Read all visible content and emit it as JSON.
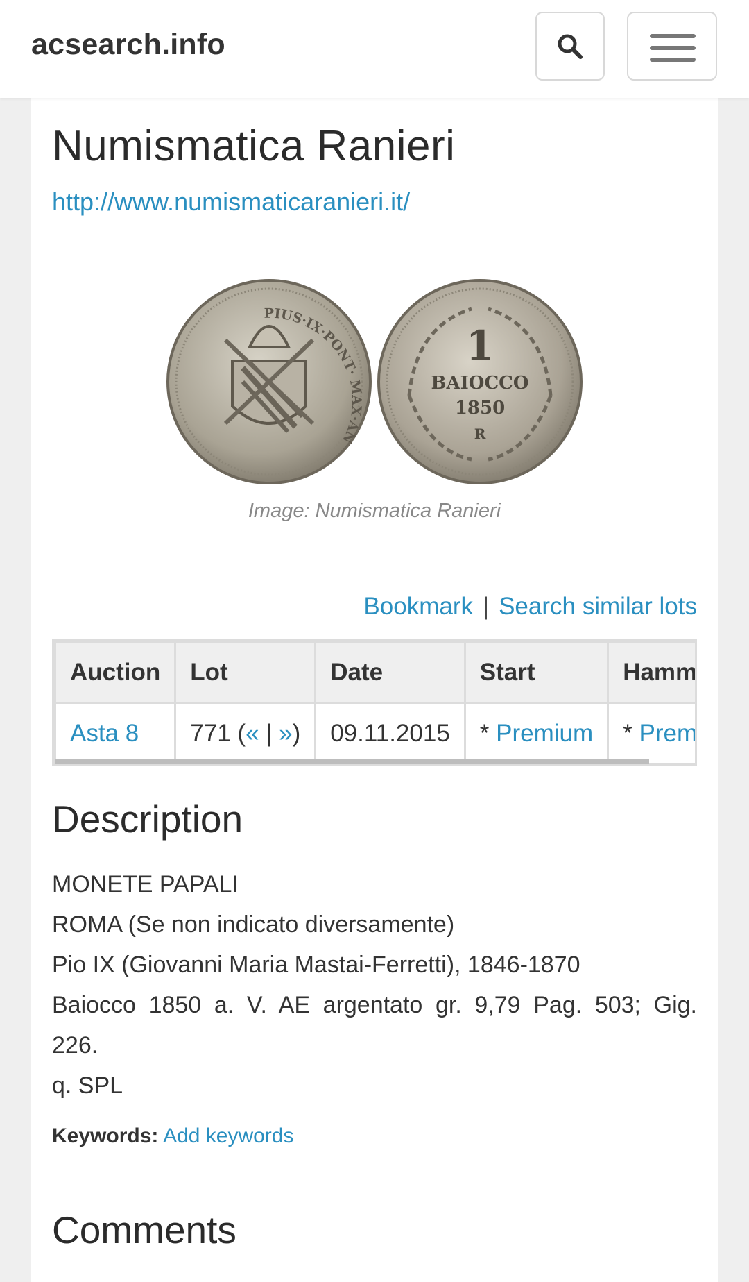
{
  "navbar": {
    "brand": "acsearch.info",
    "search_icon": "search-icon",
    "menu_icon": "hamburger-menu-icon"
  },
  "page": {
    "title": "Numismatica Ranieri",
    "site_url": "http://www.numismaticaranieri.it/"
  },
  "image": {
    "caption": "Image: Numismatica Ranieri",
    "obverse_legend": "PIUS·IX·PONT· MAX·ANNO·V",
    "reverse_denomination": "1",
    "reverse_label": "BAIOCCO",
    "reverse_year": "1850",
    "reverse_mint": "R"
  },
  "actions": {
    "bookmark": "Bookmark",
    "separator": "|",
    "search_similar": "Search similar lots"
  },
  "lot_table": {
    "headers": [
      "Auction",
      "Lot",
      "Date",
      "Start",
      "Hammer"
    ],
    "auction": "Asta 8",
    "lot_number": "771",
    "lot_prev": "«",
    "lot_sep": "|",
    "lot_next": "»",
    "date": "09.11.2015",
    "start_prefix": "*",
    "start_value": "Premium",
    "hammer_prefix": "*",
    "hammer_value": "Premium"
  },
  "description": {
    "heading": "Description",
    "lines": [
      "MONETE PAPALI",
      "ROMA (Se non indicato diversamente)",
      "Pio IX (Giovanni Maria Mastai-Ferretti), 1846-1870",
      "Baiocco 1850 a. V. AE argentato gr. 9,79 Pag. 503; Gig.",
      "226.",
      "q. SPL"
    ]
  },
  "keywords": {
    "label": "Keywords:",
    "link": "Add keywords"
  },
  "comments": {
    "heading": "Comments"
  },
  "colors": {
    "link": "#2a8fc0",
    "background": "#efefef",
    "panel": "#ffffff",
    "table_border": "#dcdcdc"
  }
}
